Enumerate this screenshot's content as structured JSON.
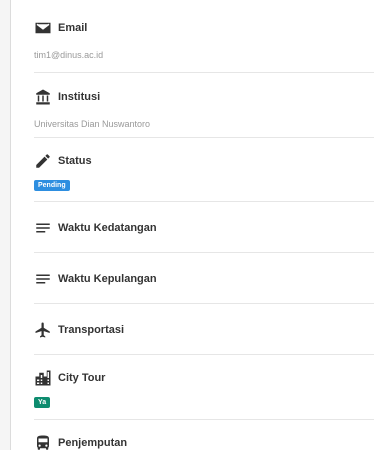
{
  "rows": [
    {
      "label": "Email",
      "icon": "envelope-icon",
      "value": "tim1@dinus.ac.id"
    },
    {
      "label": "Institusi",
      "icon": "institution-icon",
      "value": "Universitas Dian Nuswantoro"
    },
    {
      "label": "Status",
      "icon": "pencil-icon",
      "badge": "Pending",
      "badge_color": "#2d8ee0"
    },
    {
      "label": "Waktu Kedatangan",
      "icon": "lines-icon"
    },
    {
      "label": "Waktu Kepulangan",
      "icon": "lines-icon"
    },
    {
      "label": "Transportasi",
      "icon": "airplane-icon"
    },
    {
      "label": "City Tour",
      "icon": "city-icon",
      "badge": "Ya",
      "badge_color": "#0d8c6f"
    },
    {
      "label": "Penjemputan",
      "icon": "bus-icon"
    }
  ]
}
